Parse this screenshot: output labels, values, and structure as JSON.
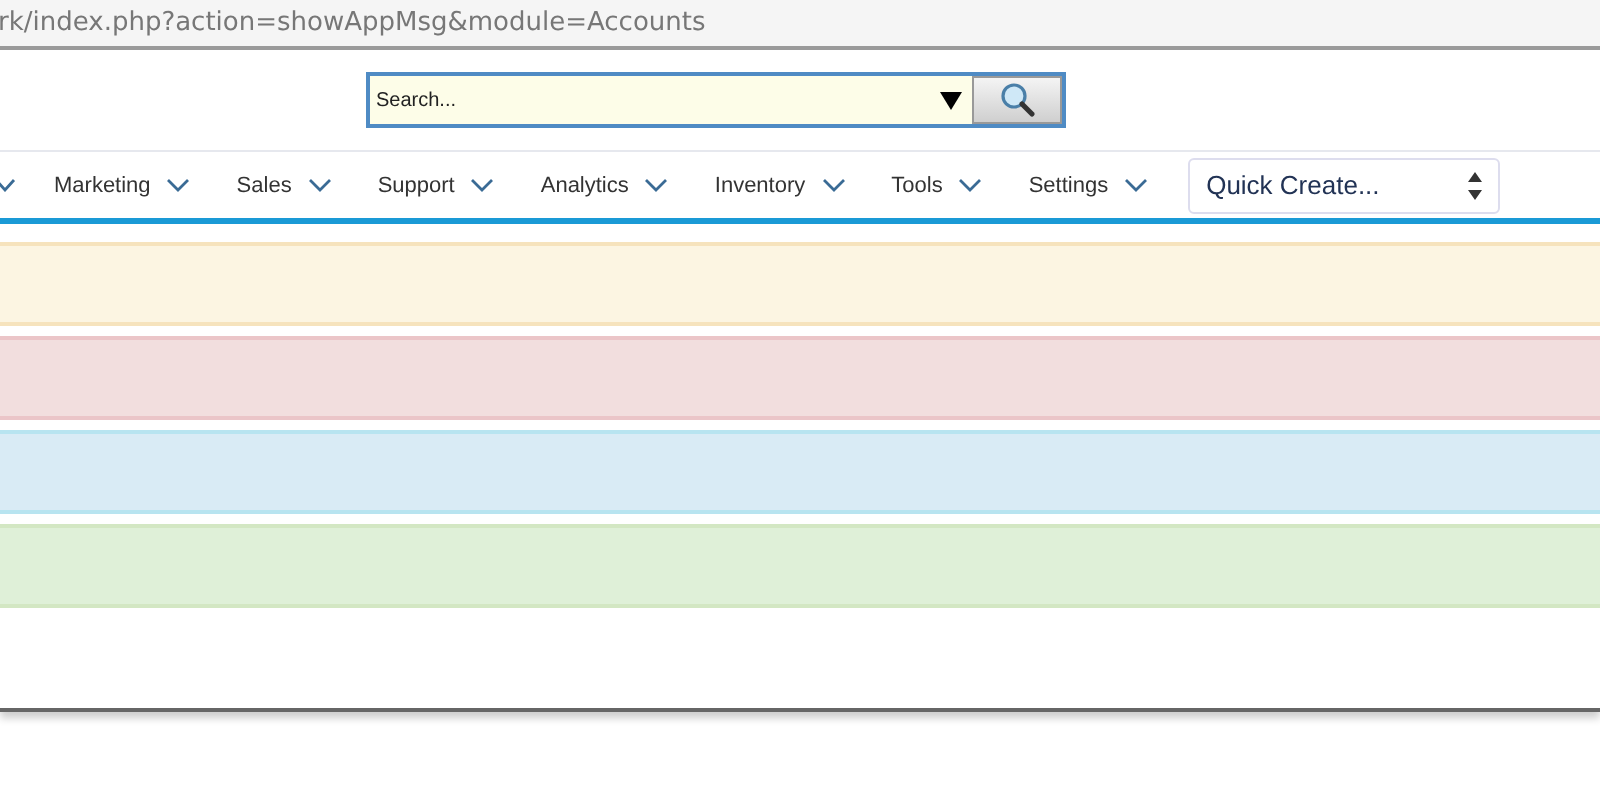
{
  "address_bar": {
    "url": "rk/index.php?action=showAppMsg&module=Accounts"
  },
  "search": {
    "placeholder": "Search..."
  },
  "nav": {
    "items": [
      {
        "label": "Marketing"
      },
      {
        "label": "Sales"
      },
      {
        "label": "Support"
      },
      {
        "label": "Analytics"
      },
      {
        "label": "Inventory"
      },
      {
        "label": "Tools"
      },
      {
        "label": "Settings"
      }
    ],
    "quick_create": "Quick Create..."
  },
  "alerts": [
    {
      "color": "#fcf5e2"
    },
    {
      "color": "#f2dede"
    },
    {
      "color": "#d9ebf5"
    },
    {
      "color": "#dff0d8"
    }
  ]
}
